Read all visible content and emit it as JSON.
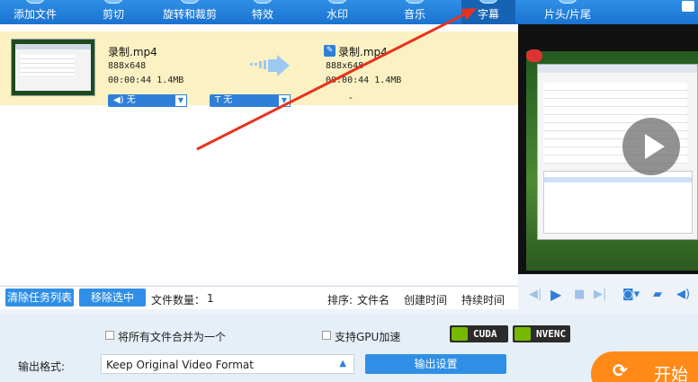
{
  "toolbar": {
    "items": [
      {
        "label": "添加文件"
      },
      {
        "label": "剪切"
      },
      {
        "label": "旋转和裁剪"
      },
      {
        "label": "特效"
      },
      {
        "label": "水印"
      },
      {
        "label": "音乐"
      },
      {
        "label": "字幕",
        "active": true
      },
      {
        "label": "片头/片尾"
      }
    ],
    "accent": "#2f8fe6",
    "active_bg": "#1663b4"
  },
  "file": {
    "source": {
      "name": "录制.mp4",
      "resolution": "888x648",
      "duration": "00:00:44",
      "size": "1.4MB"
    },
    "output": {
      "name": "录制.mp4",
      "resolution": "888x648",
      "duration": "00:00:44",
      "size": "1.4MB",
      "placeholder": "-"
    },
    "audio_track": {
      "icon": "speaker-icon",
      "glyph": "◀)",
      "label": "无"
    },
    "subtitle_track": {
      "icon": "text-icon",
      "glyph": "T",
      "label": "无"
    },
    "row_highlight": "#fbf1c2"
  },
  "taskbar": {
    "clear_label": "清除任务列表",
    "remove_label": "移除选中",
    "file_count_label": "文件数量：",
    "file_count": "1",
    "sort_label": "排序:",
    "sort_name": "文件名",
    "sort_created": "创建时间",
    "sort_duration": "持续时间"
  },
  "player": {
    "controls": [
      "prev-icon",
      "play-icon",
      "stop-icon",
      "next-icon",
      "camera-icon",
      "folder-icon",
      "volume-icon"
    ]
  },
  "options": {
    "merge_label": "将所有文件合并为一个",
    "merge_checked": false,
    "gpu_label": "支持GPU加速",
    "gpu_checked": false,
    "cuda_label": "CUDA",
    "nvenc_label": "NVENC",
    "nvidia_color": "#76b900"
  },
  "output": {
    "format_label": "输出格式:",
    "format_value": "Keep Original Video Format",
    "settings_label": "输出设置",
    "start_label": "开始",
    "start_color": "#ff8a18"
  },
  "annotation": {
    "arrow_color": "#e8321e"
  }
}
